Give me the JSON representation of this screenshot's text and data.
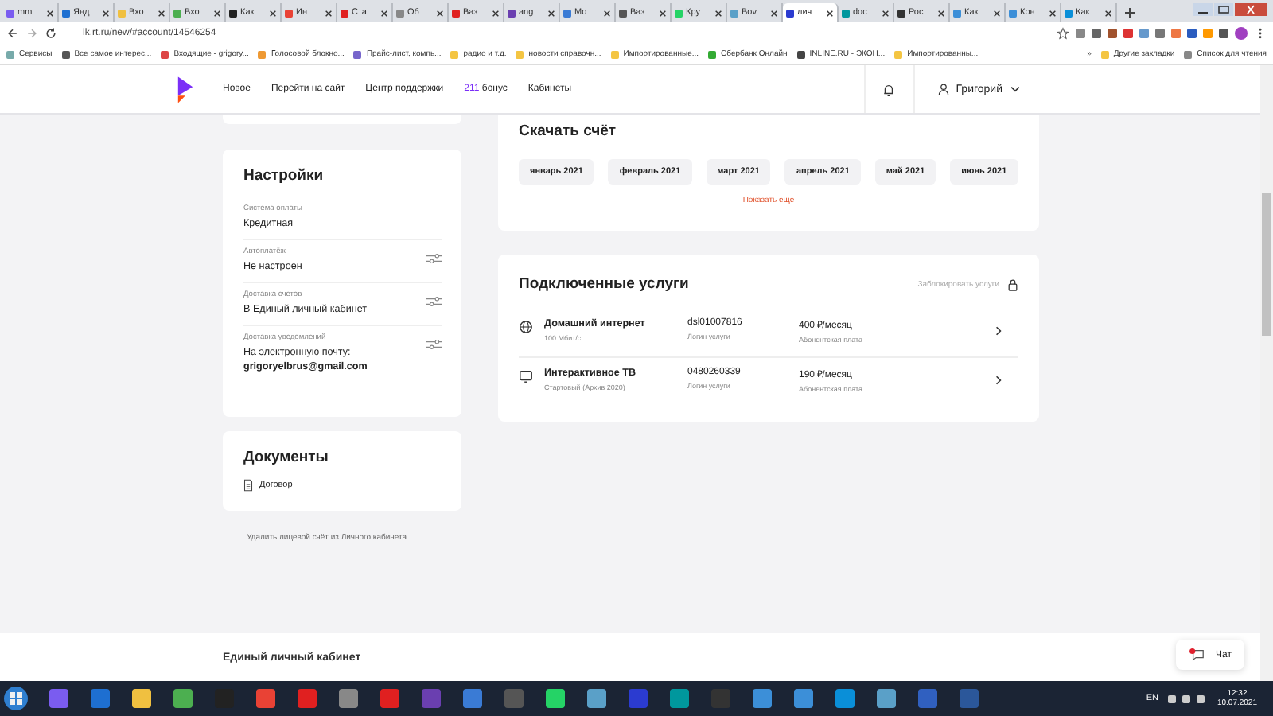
{
  "browser": {
    "tabs": [
      {
        "label": "mm",
        "selected": false
      },
      {
        "label": "Янд",
        "selected": false
      },
      {
        "label": "Вхо",
        "selected": false
      },
      {
        "label": "Вхо",
        "selected": false
      },
      {
        "label": "Как",
        "selected": false
      },
      {
        "label": "Инт",
        "selected": false
      },
      {
        "label": "Ста",
        "selected": false
      },
      {
        "label": "Об",
        "selected": false
      },
      {
        "label": "Ваз",
        "selected": false
      },
      {
        "label": "ang",
        "selected": false
      },
      {
        "label": "Мо",
        "selected": false
      },
      {
        "label": "Ваз",
        "selected": false
      },
      {
        "label": "Кру",
        "selected": false
      },
      {
        "label": "Bov",
        "selected": false
      },
      {
        "label": "лич",
        "selected": true
      },
      {
        "label": "doc",
        "selected": false
      },
      {
        "label": "Рос",
        "selected": false
      },
      {
        "label": "Как",
        "selected": false
      },
      {
        "label": "Кон",
        "selected": false
      },
      {
        "label": "Как",
        "selected": false
      }
    ],
    "address": "lk.rt.ru/new/#account/14546254",
    "bookmarks": [
      "Сервисы",
      "Все самое интерес...",
      "Входящие - grigory...",
      "Голосовой блокно...",
      "Прайс-лист, компь...",
      "радио и т.д.",
      "новости справочн...",
      "Импортированные...",
      "Сбербанк Онлайн",
      "INLINE.RU - ЭКОН...",
      "Импортированны..."
    ],
    "bookmarks_more": "»",
    "other_bookmarks": "Другие закладки",
    "reading_list": "Список для чтения"
  },
  "header": {
    "nav": [
      "Новое",
      "Перейти на сайт",
      "Центр поддержки"
    ],
    "bonus_number": "211",
    "bonus_label": "бонус",
    "cabinets": "Кабинеты",
    "user": "Григорий"
  },
  "settings": {
    "title": "Настройки",
    "items": [
      {
        "label": "Система оплаты",
        "value": "Кредитная",
        "adjustable": false
      },
      {
        "label": "Автоплатёж",
        "value": "Не настроен",
        "adjustable": true
      },
      {
        "label": "Доставка счетов",
        "value": "В Единый личный кабинет",
        "adjustable": true
      },
      {
        "label": "Доставка уведомлений",
        "value": "На электронную почту:",
        "email": "grigoryelbrus@gmail.com",
        "adjustable": true
      }
    ]
  },
  "documents": {
    "title": "Документы",
    "items": [
      "Договор"
    ]
  },
  "delete_link": "Удалить лицевой счёт из Личного кабинета",
  "invoice": {
    "title": "Скачать счёт",
    "months": [
      "январь 2021",
      "февраль 2021",
      "март 2021",
      "апрель 2021",
      "май 2021",
      "июнь 2021"
    ],
    "more": "Показать ещё"
  },
  "services": {
    "title": "Подключенные услуги",
    "block": "Заблокировать услуги",
    "items": [
      {
        "kind": "internet",
        "name": "Домашний интернет",
        "detail": "100 Мбит/с",
        "login": "dsl01007816",
        "login_label": "Логин услуги",
        "price": "400 ₽/месяц",
        "price_label": "Абонентская плата"
      },
      {
        "kind": "tv",
        "name": "Интерактивное ТВ",
        "detail": "Стартовый (Архив 2020)",
        "login": "0480260339",
        "login_label": "Логин услуги",
        "price": "190 ₽/месяц",
        "price_label": "Абонентская плата"
      }
    ]
  },
  "footer": {
    "title": "Единый личный кабинет",
    "chat": "Чат"
  },
  "taskbar": {
    "lang": "EN",
    "time": "12:32",
    "date": "10.07.2021"
  }
}
